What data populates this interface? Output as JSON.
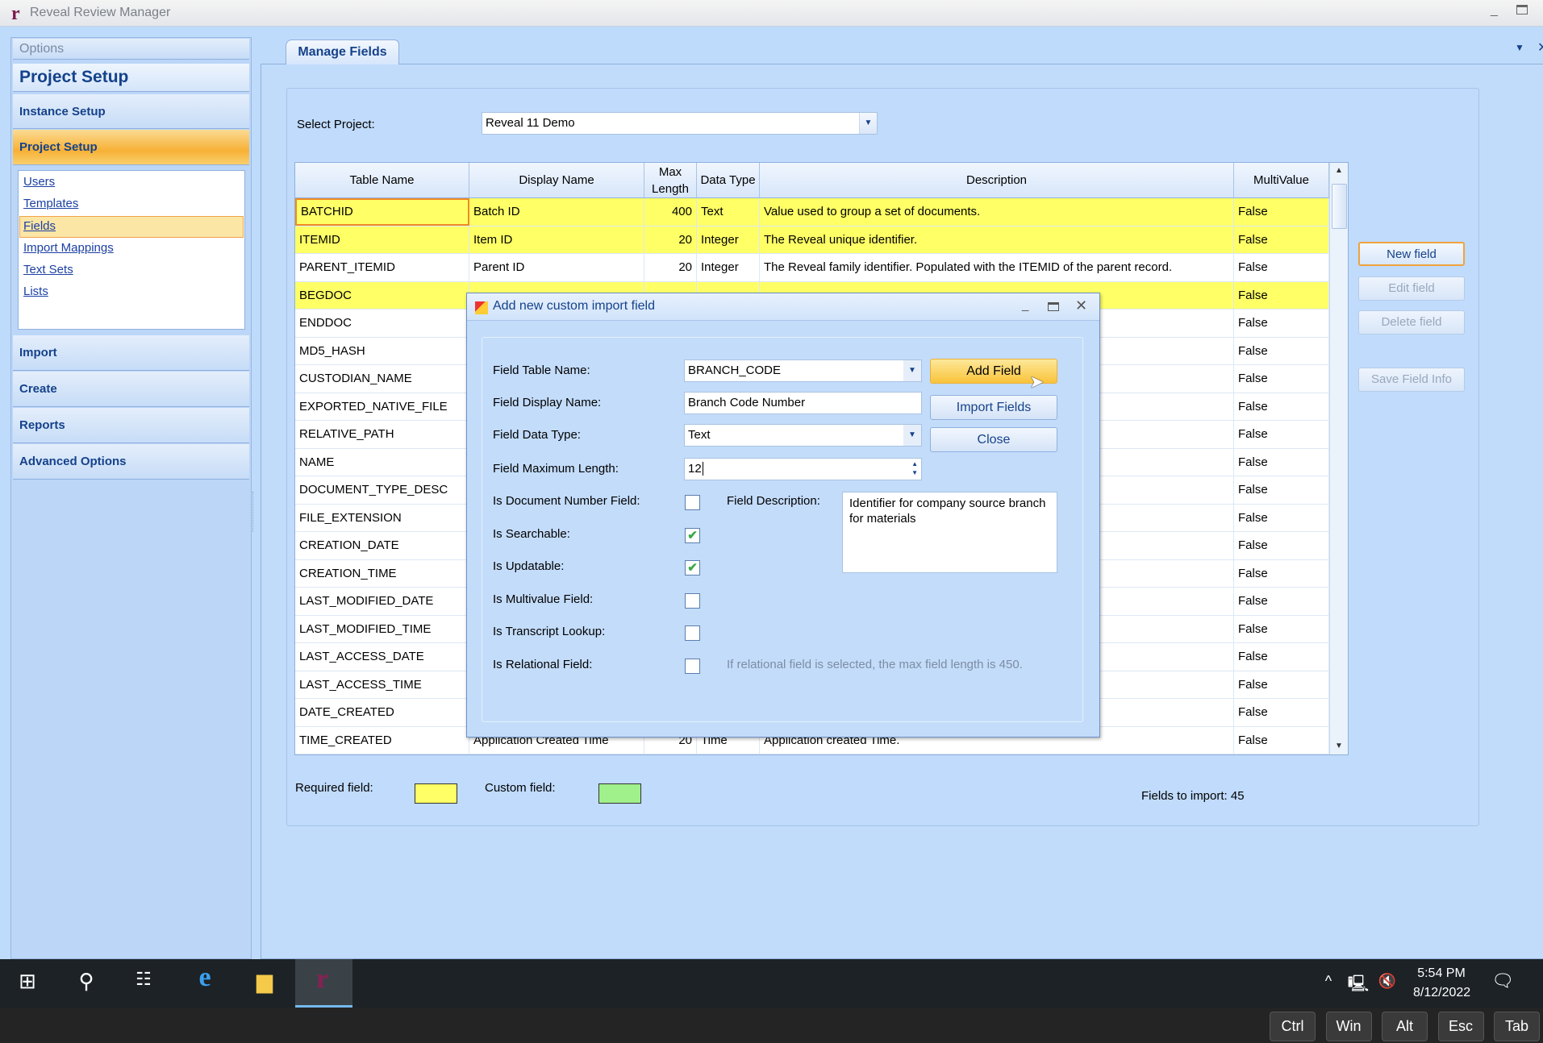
{
  "window": {
    "title": "Reveal Review Manager",
    "logo": "r"
  },
  "sidebar": {
    "options_label": "Options",
    "title": "Project Setup",
    "sections": [
      {
        "label": "Instance Setup",
        "selected": false
      },
      {
        "label": "Project Setup",
        "selected": true
      }
    ],
    "links": [
      {
        "label": "Users"
      },
      {
        "label": "Templates"
      },
      {
        "label": "Fields",
        "selected": true
      },
      {
        "label": "Import Mappings"
      },
      {
        "label": "Text Sets"
      },
      {
        "label": "Lists"
      }
    ],
    "lower_sections": [
      {
        "label": "Import"
      },
      {
        "label": "Create"
      },
      {
        "label": "Reports"
      },
      {
        "label": "Advanced Options"
      }
    ]
  },
  "tab": {
    "label": "Manage Fields"
  },
  "project": {
    "label": "Select Project:",
    "value": "Reveal 11 Demo"
  },
  "grid": {
    "columns": [
      "Table Name",
      "Display Name",
      "Max Length",
      "Data Type",
      "Description",
      "MultiValue"
    ],
    "rows": [
      {
        "table": "BATCHID",
        "display": "Batch ID",
        "max": "400",
        "type": "Text",
        "desc": "Value used to group a set of documents.",
        "multi": "False",
        "required": true,
        "selected": true
      },
      {
        "table": "ITEMID",
        "display": "Item ID",
        "max": "20",
        "type": "Integer",
        "desc": "The Reveal unique identifier.",
        "multi": "False",
        "required": true
      },
      {
        "table": "PARENT_ITEMID",
        "display": "Parent ID",
        "max": "20",
        "type": "Integer",
        "desc": "The Reveal family identifier. Populated with the ITEMID of the parent record.",
        "multi": "False"
      },
      {
        "table": "BEGDOC",
        "multi": "False",
        "required": true
      },
      {
        "table": "ENDDOC",
        "multi": "False"
      },
      {
        "table": "MD5_HASH",
        "multi": "False"
      },
      {
        "table": "CUSTODIAN_NAME",
        "multi": "False"
      },
      {
        "table": "EXPORTED_NATIVE_FILE",
        "multi": "False"
      },
      {
        "table": "RELATIVE_PATH",
        "multi": "False"
      },
      {
        "table": "NAME",
        "multi": "False"
      },
      {
        "table": "DOCUMENT_TYPE_DESC",
        "multi": "False"
      },
      {
        "table": "FILE_EXTENSION",
        "multi": "False"
      },
      {
        "table": "CREATION_DATE",
        "multi": "False"
      },
      {
        "table": "CREATION_TIME",
        "multi": "False"
      },
      {
        "table": "LAST_MODIFIED_DATE",
        "multi": "False"
      },
      {
        "table": "LAST_MODIFIED_TIME",
        "multi": "False"
      },
      {
        "table": "LAST_ACCESS_DATE",
        "multi": "False"
      },
      {
        "table": "LAST_ACCESS_TIME",
        "multi": "False"
      },
      {
        "table": "DATE_CREATED",
        "multi": "False"
      },
      {
        "table": "TIME_CREATED",
        "display": "Application Created Time",
        "max": "20",
        "type": "Time",
        "desc": "Application created Time.",
        "multi": "False"
      }
    ]
  },
  "buttons": {
    "new_field": "New field",
    "edit_field": "Edit field",
    "delete_field": "Delete field",
    "save_field_info": "Save Field Info"
  },
  "legend": {
    "required_label": "Required field:",
    "custom_label": "Custom field:",
    "required_color": "#ffff66",
    "custom_color": "#a0f08c",
    "fields_to_import": "Fields to import: 45"
  },
  "dialog": {
    "title": "Add new custom import field",
    "table_name_label": "Field Table Name:",
    "table_name": "BRANCH_CODE",
    "display_name_label": "Field Display Name:",
    "display_name": "Branch Code Number",
    "data_type_label": "Field Data Type:",
    "data_type": "Text",
    "max_length_label": "Field Maximum Length:",
    "max_length": "12",
    "add_field": "Add Field",
    "import_fields": "Import Fields",
    "close": "Close",
    "checks": [
      {
        "label": "Is Document Number Field:",
        "checked": false
      },
      {
        "label": "Is Searchable:",
        "checked": true
      },
      {
        "label": "Is Updatable:",
        "checked": true
      },
      {
        "label": "Is Multivalue Field:",
        "checked": false
      },
      {
        "label": "Is Transcript Lookup:",
        "checked": false
      },
      {
        "label": "Is Relational Field:",
        "checked": false
      }
    ],
    "description_label": "Field Description:",
    "description": "Identifier for company source branch for materials",
    "relational_note": "If relational field is selected, the max field length is 450."
  },
  "taskbar": {
    "time": "5:54 PM",
    "date": "8/12/2022"
  },
  "keys": [
    "Ctrl",
    "Win",
    "Alt",
    "Esc",
    "Tab"
  ]
}
